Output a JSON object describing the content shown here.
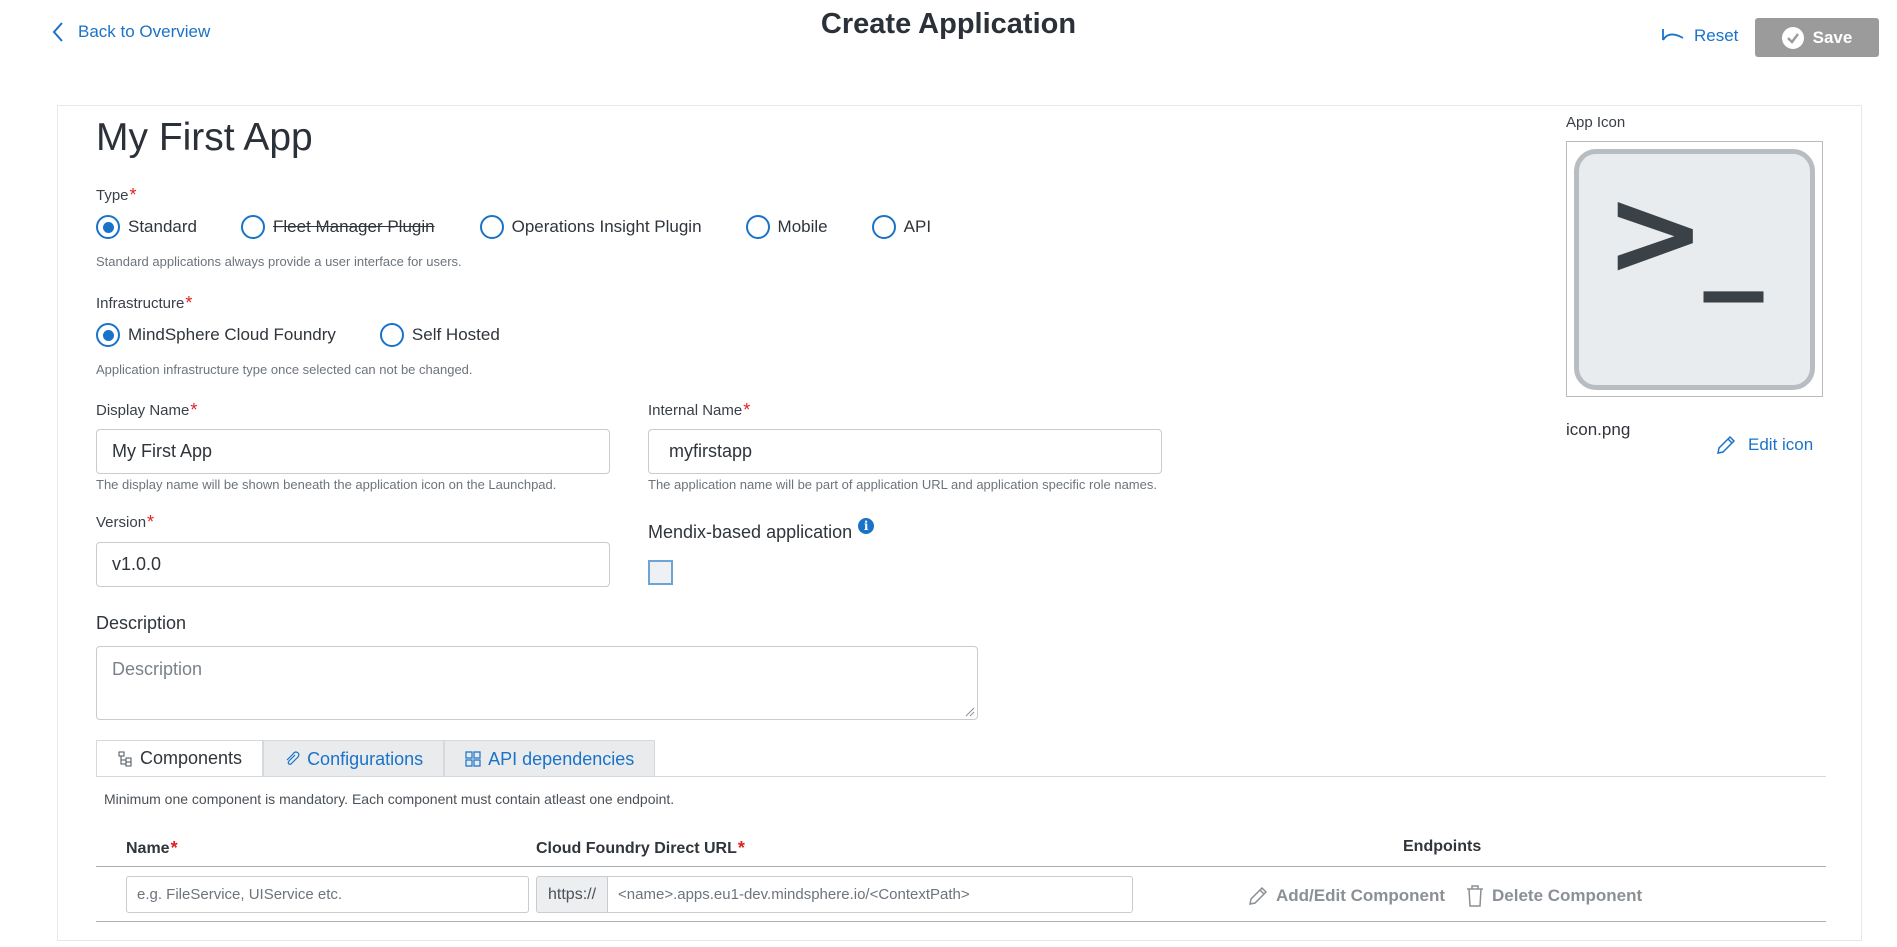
{
  "header": {
    "back_label": "Back to Overview",
    "title": "Create Application",
    "reset_label": "Reset",
    "save_label": "Save"
  },
  "app": {
    "name": "My First App"
  },
  "type": {
    "label": "Type",
    "options": [
      "Standard",
      "Fleet Manager Plugin",
      "Operations Insight Plugin",
      "Mobile",
      "API"
    ],
    "selected": "Standard",
    "hint": "Standard applications always provide a user interface for users."
  },
  "infrastructure": {
    "label": "Infrastructure",
    "options": [
      "MindSphere Cloud Foundry",
      "Self Hosted"
    ],
    "selected": "MindSphere Cloud Foundry",
    "hint": "Application infrastructure type once selected can not be changed."
  },
  "display_name": {
    "label": "Display Name",
    "value": "My First App",
    "hint": "The display name will be shown beneath the application icon on the Launchpad."
  },
  "internal_name": {
    "label": "Internal Name",
    "value": "myfirstapp",
    "hint": "The application name will be part of application URL and application specific role names."
  },
  "version": {
    "label": "Version",
    "value": "v1.0.0"
  },
  "mendix": {
    "label": "Mendix-based application",
    "checked": false
  },
  "description": {
    "label": "Description",
    "placeholder": "Description"
  },
  "icon_panel": {
    "label": "App Icon",
    "glyph": ">_",
    "filename": "icon.png",
    "edit_label": "Edit icon"
  },
  "tabs": [
    {
      "label": "Components",
      "icon": "tree-icon",
      "active": true
    },
    {
      "label": "Configurations",
      "icon": "paperclip-icon",
      "active": false
    },
    {
      "label": "API dependencies",
      "icon": "grid-icon",
      "active": false
    }
  ],
  "components": {
    "note": "Minimum one component is mandatory. Each component must contain atleast one endpoint.",
    "columns": {
      "name": "Name",
      "url": "Cloud Foundry Direct URL",
      "endpoints": "Endpoints"
    },
    "name_placeholder": "e.g. FileService, UIService etc.",
    "url_prefix": "https://",
    "url_placeholder": "<name>.apps.eu1-dev.mindsphere.io/<ContextPath>",
    "add_edit_label": "Add/Edit Component",
    "delete_label": "Delete Component"
  },
  "colors": {
    "accent": "#1a73c9",
    "required": "#e02020",
    "save_disabled": "#9b9b9b"
  }
}
